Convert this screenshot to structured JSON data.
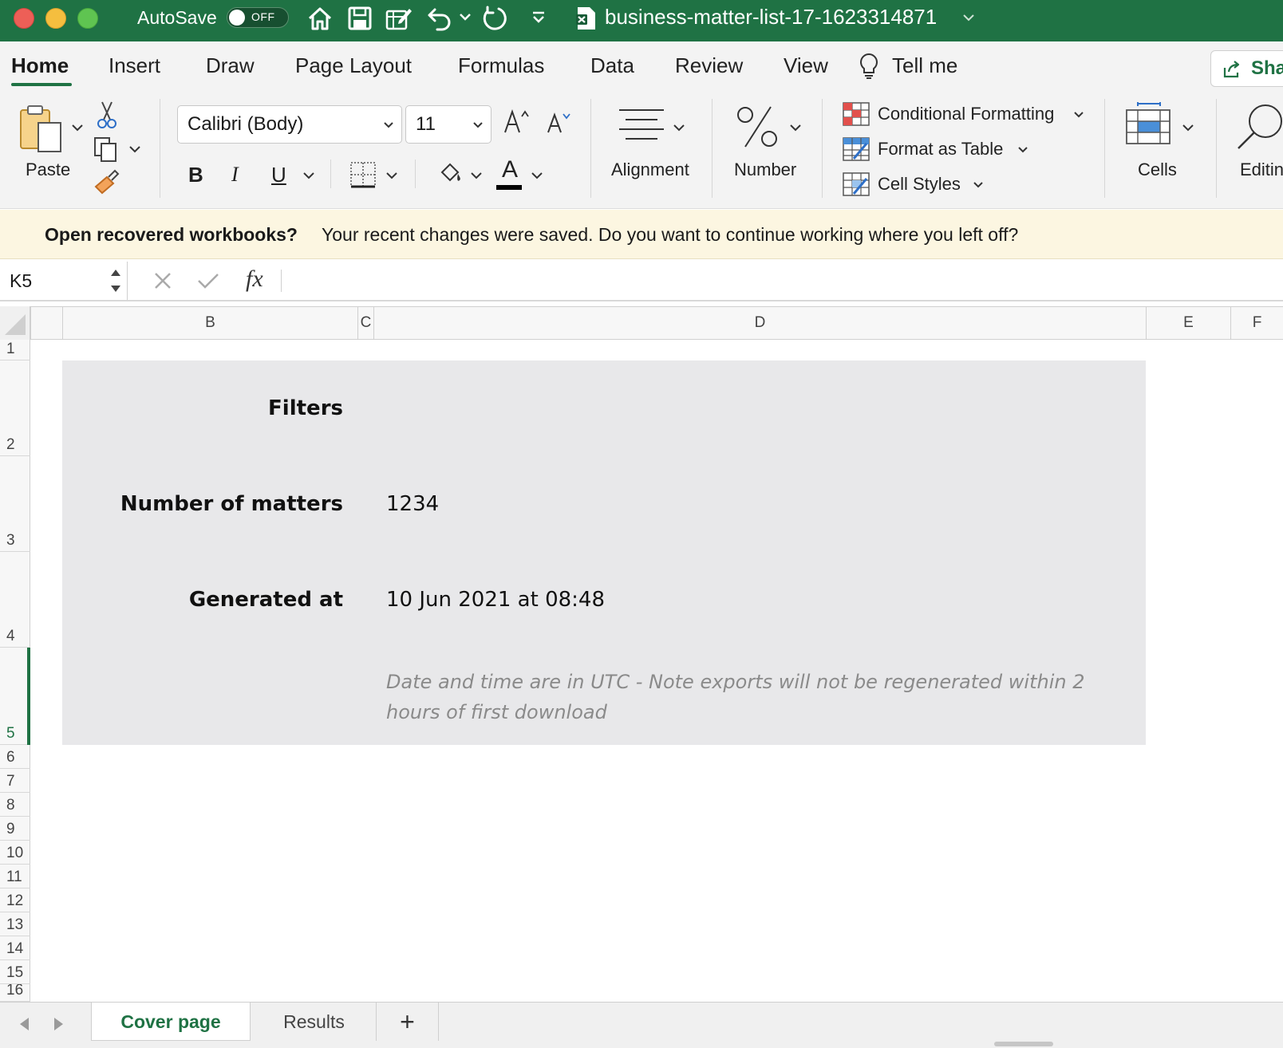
{
  "titlebar": {
    "autosave_label": "AutoSave",
    "autosave_state": "OFF",
    "filename": "business-matter-list-17-1623314871",
    "background": "#1f7244"
  },
  "ribbon_tabs": [
    "Home",
    "Insert",
    "Draw",
    "Page Layout",
    "Formulas",
    "Data",
    "Review",
    "View"
  ],
  "tell_me": "Tell me",
  "share_label": "Share",
  "ribbon": {
    "paste_label": "Paste",
    "font_name": "Calibri (Body)",
    "font_size": "11",
    "bold_icon": "B",
    "italic_icon": "I",
    "underline_icon": "U",
    "font_color_glyph": "A",
    "alignment_label": "Alignment",
    "number_label": "Number",
    "conditional_formatting": "Conditional Formatting",
    "format_as_table": "Format as Table",
    "cell_styles": "Cell Styles",
    "cells_label": "Cells",
    "editing_label": "Editing"
  },
  "recovery": {
    "title": "Open recovered workbooks?",
    "message": "Your recent changes were saved. Do you want to continue working where you left off?"
  },
  "formula_bar": {
    "name_box": "K5",
    "fx_label": "fx",
    "formula": ""
  },
  "columns": [
    "B",
    "C",
    "D",
    "E",
    "F"
  ],
  "rows": [
    "1",
    "2",
    "3",
    "4",
    "5",
    "6",
    "7",
    "8",
    "9",
    "10",
    "11",
    "12",
    "13",
    "14",
    "15",
    "16"
  ],
  "sheet": {
    "filters_label": "Filters",
    "matters_label": "Number of matters",
    "matters_value": "1234",
    "generated_label": "Generated at",
    "generated_value": "10 Jun 2021 at 08:48",
    "note": "Date and time are in UTC - Note exports will not be regenerated within 2 hours of first download"
  },
  "sheet_tabs": [
    "Cover page",
    "Results"
  ],
  "add_sheet": "+",
  "colors": {
    "accent": "#1f7244",
    "cover_fill": "#e8e8ea",
    "recovery_bg": "#fcf6e1",
    "note_text": "#8a8a8a"
  }
}
